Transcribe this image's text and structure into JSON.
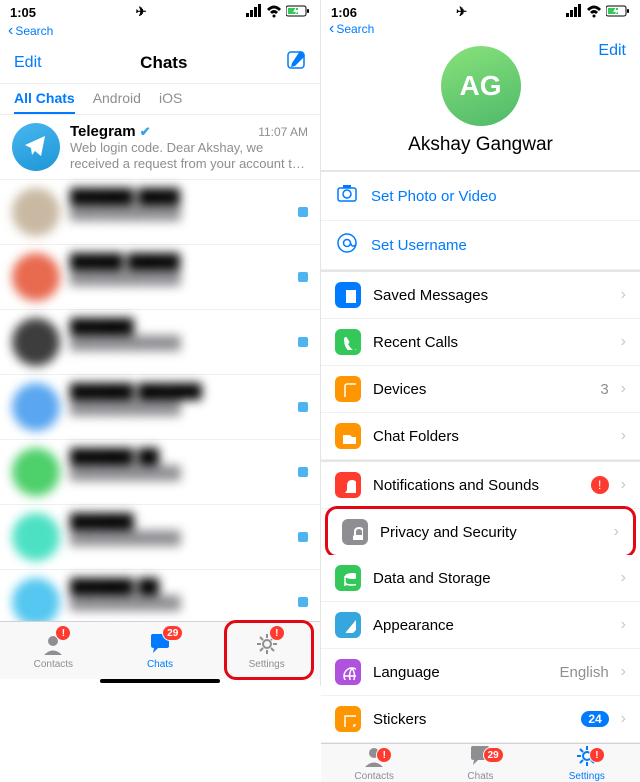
{
  "left": {
    "status_time": "1:05",
    "search_label": "Search",
    "header": {
      "edit": "Edit",
      "title": "Chats"
    },
    "tabs": [
      "All Chats",
      "Android",
      "iOS"
    ],
    "active_tab": 0,
    "chats": [
      {
        "name": "Telegram",
        "verified": true,
        "time": "11:07 AM",
        "msg": "Web login code. Dear Akshay, we received a request from your account to log in on my.tele…",
        "avatar": "#33a1e6",
        "blur": false
      },
      {
        "name": "██████ ████",
        "time": "",
        "msg": "████████████",
        "avatar": "#c9b9a3",
        "blur": true
      },
      {
        "name": "█████ █████",
        "time": "",
        "msg": "████████████",
        "avatar": "#e86a4f",
        "blur": true
      },
      {
        "name": "██████",
        "time": "",
        "msg": "████████████",
        "avatar": "#3d3d3d",
        "blur": true
      },
      {
        "name": "██████ ██████",
        "time": "",
        "msg": "████████████",
        "avatar": "#5aa6f0",
        "blur": true
      },
      {
        "name": "██████ ██",
        "time": "",
        "msg": "████████████",
        "avatar": "#4ed06b",
        "blur": true
      },
      {
        "name": "██████",
        "time": "",
        "msg": "████████████",
        "avatar": "#4de1c4",
        "blur": true
      },
      {
        "name": "██████ ██",
        "time": "",
        "msg": "████████████",
        "avatar": "#55c7f0",
        "blur": true
      }
    ],
    "tabbar": {
      "contacts": "Contacts",
      "chats": "Chats",
      "settings": "Settings",
      "contacts_badge": "!",
      "chats_badge": "29",
      "settings_badge": "!"
    }
  },
  "right": {
    "status_time": "1:06",
    "search_label": "Search",
    "edit": "Edit",
    "avatar_initials": "AG",
    "name": "Akshay Gangwar",
    "actions": {
      "photo": "Set Photo or Video",
      "username": "Set Username"
    },
    "group1": [
      {
        "icon": "bookmark",
        "color": "#007aff",
        "label": "Saved Messages"
      },
      {
        "icon": "phone",
        "color": "#34c759",
        "label": "Recent Calls"
      },
      {
        "icon": "device",
        "color": "#ff9500",
        "label": "Devices",
        "value": "3"
      },
      {
        "icon": "folder",
        "color": "#ff9500",
        "label": "Chat Folders"
      }
    ],
    "group2": [
      {
        "icon": "bell",
        "color": "#ff3b30",
        "label": "Notifications and Sounds",
        "alert": true
      },
      {
        "icon": "lock",
        "color": "#8e8e93",
        "label": "Privacy and Security",
        "highlight": true
      },
      {
        "icon": "data",
        "color": "#34c759",
        "label": "Data and Storage"
      },
      {
        "icon": "brush",
        "color": "#36a6de",
        "label": "Appearance"
      },
      {
        "icon": "globe",
        "color": "#af52de",
        "label": "Language",
        "value": "English"
      },
      {
        "icon": "sticker",
        "color": "#ff9500",
        "label": "Stickers",
        "pill": "24"
      }
    ],
    "tabbar": {
      "contacts": "Contacts",
      "chats": "Chats",
      "settings": "Settings",
      "contacts_badge": "!",
      "chats_badge": "29",
      "settings_badge": "!"
    }
  }
}
